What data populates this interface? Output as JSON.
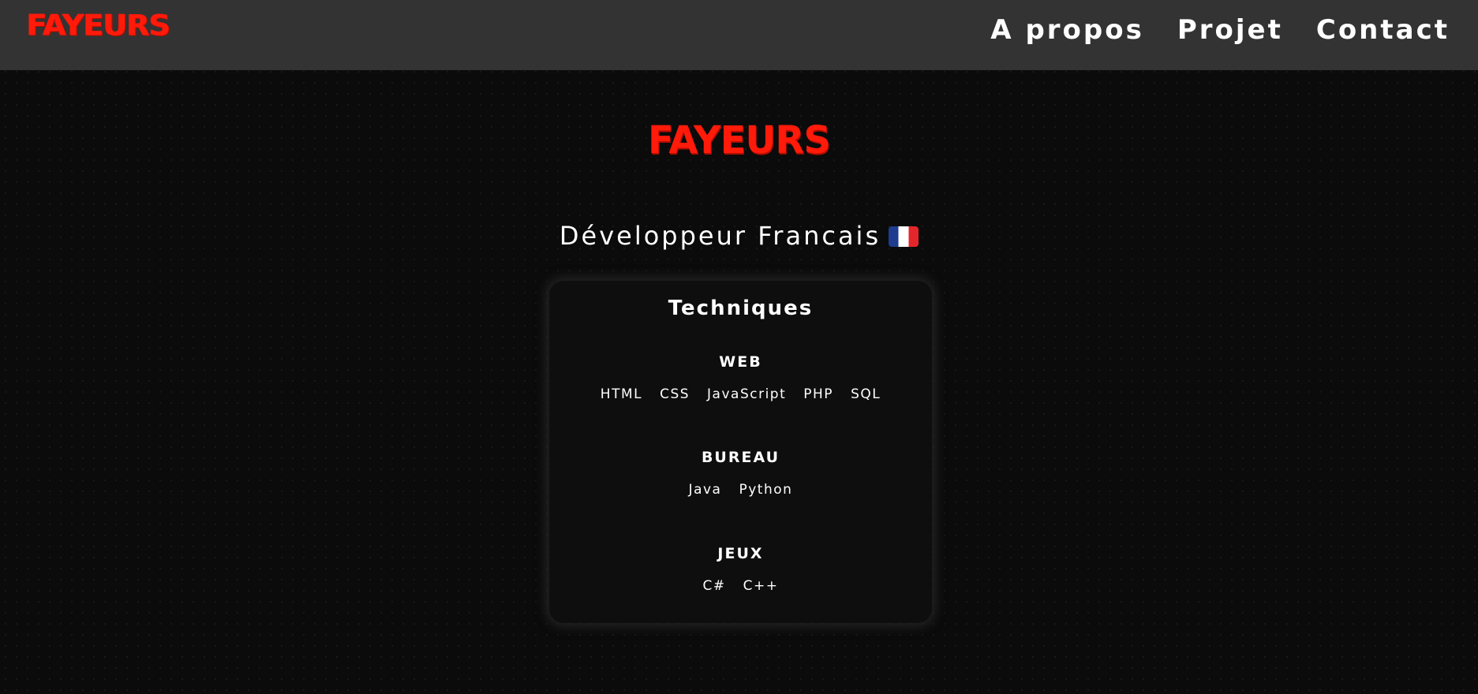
{
  "header": {
    "logo": "FAYEURS",
    "nav": [
      {
        "label": "A propos"
      },
      {
        "label": "Projet"
      },
      {
        "label": "Contact"
      }
    ]
  },
  "hero": {
    "logo": "FAYEURS",
    "subtitle": "Développeur Francais",
    "flag_icon": "france-flag-icon"
  },
  "skills": {
    "title": "Techniques",
    "groups": [
      {
        "title": "WEB",
        "items": [
          "HTML",
          "CSS",
          "JavaScript",
          "PHP",
          "SQL"
        ]
      },
      {
        "title": "BUREAU",
        "items": [
          "Java",
          "Python"
        ]
      },
      {
        "title": "JEUX",
        "items": [
          "C#",
          "C++"
        ]
      }
    ]
  },
  "colors": {
    "accent": "#ff1a0a",
    "header_bg": "#333333",
    "page_bg": "#0b0b0b"
  }
}
